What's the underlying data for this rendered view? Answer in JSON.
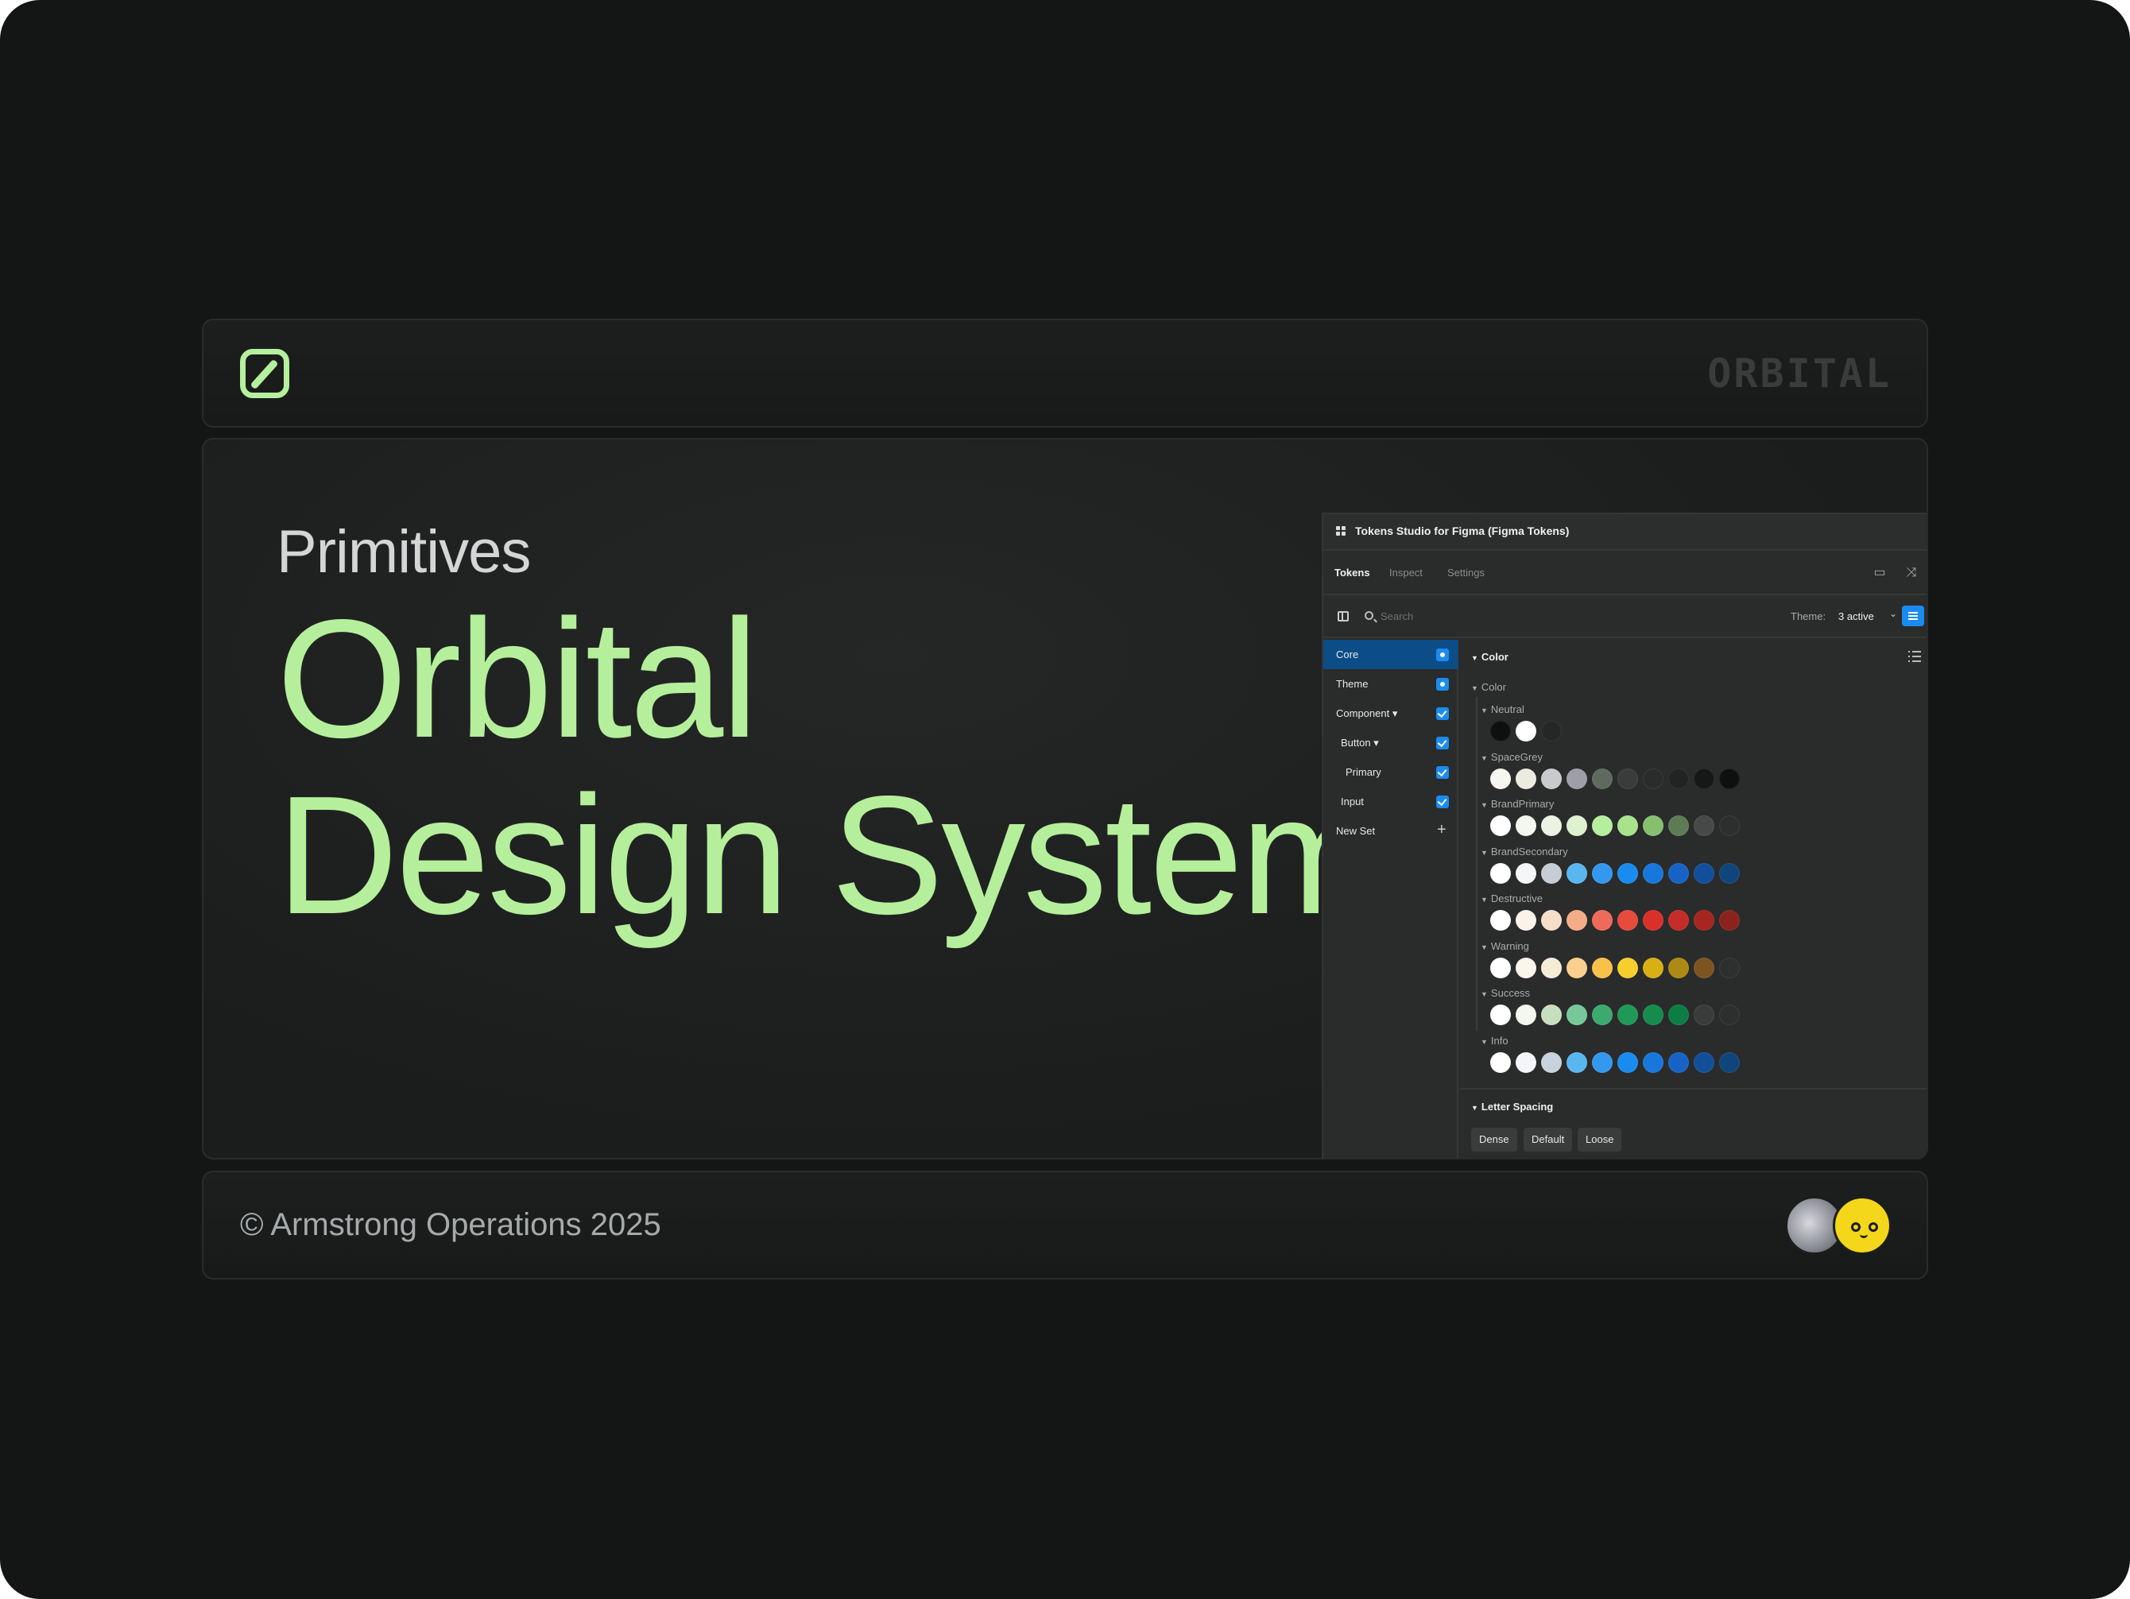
{
  "header": {
    "logo_icon": "pencil-square-icon",
    "wordmark": "ORBITAL"
  },
  "hero": {
    "eyebrow": "Primitives",
    "title_line1": "Orbital",
    "title_line2": "Design System"
  },
  "plugin": {
    "title": "Tokens Studio for Figma (Figma Tokens)",
    "tabs": [
      "Tokens",
      "Inspect",
      "Settings"
    ],
    "search_placeholder": "Search",
    "theme_label": "Theme:",
    "theme_value": "3 active",
    "sidebar": [
      {
        "label": "Core",
        "active": true
      },
      {
        "label": "Theme"
      },
      {
        "label": "Component ▾"
      },
      {
        "label": "Button ▾"
      },
      {
        "label": "Primary"
      },
      {
        "label": "Input"
      },
      {
        "label": "New Set"
      }
    ],
    "section_title": "Color",
    "subsection_title": "Color",
    "groups": [
      {
        "name": "Neutral",
        "colors": [
          "#0e0f0f",
          "#ffffff",
          "#252727"
        ]
      },
      {
        "name": "SpaceGrey",
        "colors": [
          "#f6f5ef",
          "#ecebe0",
          "#c9cacc",
          "#9d9ea8",
          "#5e6a5e",
          "#3a3c3c",
          "#2a2c2c",
          "#222424",
          "#161717",
          "#0e0f0f"
        ]
      },
      {
        "name": "BrandPrimary",
        "colors": [
          "#ffffff",
          "#f4f7ef",
          "#ecf3e2",
          "#dff2cf",
          "#b5ef9b",
          "#a6e38c",
          "#86c06e",
          "#5f7b56",
          "#474948",
          "#2d2f2e"
        ]
      },
      {
        "name": "BrandSecondary",
        "colors": [
          "#ffffff",
          "#f4f6f8",
          "#c6cdd5",
          "#5ab6ee",
          "#3399ee",
          "#1a8cf0",
          "#1877dc",
          "#1663c6",
          "#124f9a",
          "#0f457a"
        ]
      },
      {
        "name": "Destructive",
        "colors": [
          "#ffffff",
          "#fbf2ea",
          "#f6dfca",
          "#f5ad87",
          "#ef6a5a",
          "#e64b3c",
          "#d9302a",
          "#c52c27",
          "#a72521",
          "#8c221e"
        ]
      },
      {
        "name": "Warning",
        "colors": [
          "#ffffff",
          "#fbf6ec",
          "#f6ecd6",
          "#fbcf8d",
          "#fac14a",
          "#f6cf2c",
          "#d9af14",
          "#ad8a13",
          "#7d5523",
          "#2d2f2e"
        ]
      },
      {
        "name": "Success",
        "colors": [
          "#ffffff",
          "#f3f7ef",
          "#c8dfbf",
          "#77c79a",
          "#3caa6f",
          "#1f9858",
          "#158b4d",
          "#0d7e43",
          "#3a3c3c",
          "#2d2f2e"
        ]
      },
      {
        "name": "Info",
        "colors": [
          "#ffffff",
          "#f3f5f8",
          "#c8d2dc",
          "#5ab6ee",
          "#3399ee",
          "#1a8cf0",
          "#1877dc",
          "#1663c6",
          "#124f9a",
          "#0f457a"
        ]
      }
    ],
    "letter_spacing_title": "Letter Spacing",
    "letter_spacing_options": [
      "Dense",
      "Default",
      "Loose"
    ]
  },
  "footer": {
    "copyright": "© Armstrong Operations 2025",
    "avatars": [
      "astronaut-avatar",
      "yellow-smiley-avatar"
    ]
  }
}
